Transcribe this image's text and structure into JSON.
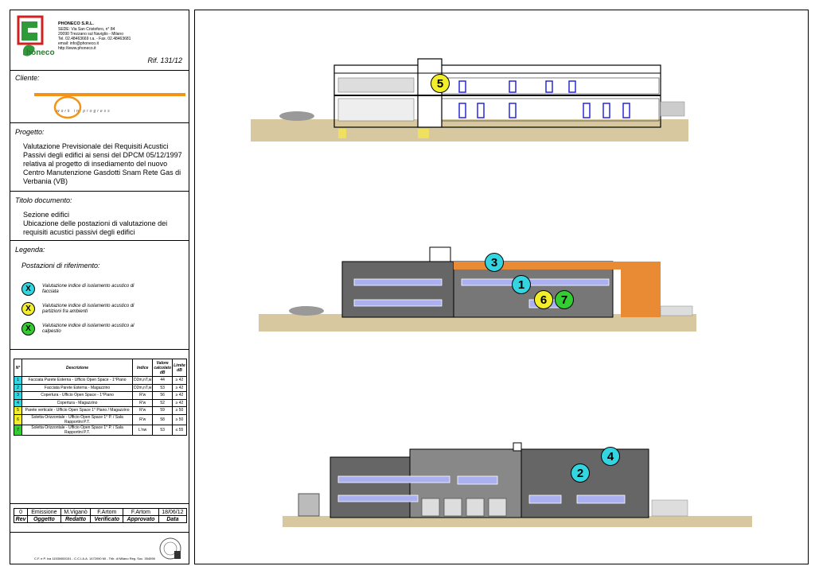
{
  "company": {
    "logo_text": "honeco",
    "name": "PHONECO S.R.L.",
    "address1": "SEDE: Via San Cristoforo, n° 84",
    "address2": "20090 Trezzano sul Naviglio - Milano",
    "phone": "Tel. 02.48463669 r.a. - Fax. 02.48463681",
    "email": "email: info@phoneco.it",
    "web": "http://www.phoneco.it",
    "ref": "Rif. 131/12"
  },
  "client": {
    "label": "Cliente:",
    "logo_text": "work in progress"
  },
  "project": {
    "label": "Progetto:",
    "text": "Valutazione Previsionale dei Requisiti Acustici Passivi degli edifici ai sensi del DPCM 05/12/1997 relativa al progetto di insediamento del nuovo Centro Manutenzione Gasdotti Snam Rete Gas di Verbania (VB)"
  },
  "doc_title": {
    "label": "Titolo documento:",
    "line1": "Sezione edifici",
    "line2": "Ubicazione delle postazioni di valutazione dei requisiti acustici passivi degli edifici"
  },
  "legend": {
    "label": "Legenda:",
    "subtitle": "Postazioni di riferimento:",
    "items": [
      {
        "mark": "X",
        "color": "#33d6e0",
        "text": "Valutazione indice di isolamento acustico di facciata"
      },
      {
        "mark": "X",
        "color": "#f2ee2a",
        "text": "Valutazione indice di isolamento acustico di partizioni fra ambienti"
      },
      {
        "mark": "X",
        "color": "#33cc33",
        "text": "Valutazione indice di isolamento acustico al calpestio"
      }
    ]
  },
  "limits_table": {
    "headers": [
      "N°",
      "Descrizione",
      "Indice",
      "Valore calcolato dB",
      "Limite dB"
    ],
    "rows": [
      {
        "n": "1",
        "color": "#33d6e0",
        "desc": "Facciata Parete Esterna - Ufficio Open Space - 1°Piano",
        "idx": "D2m,nT,w",
        "val": "44",
        "lim": "≥ 42"
      },
      {
        "n": "2",
        "color": "#33d6e0",
        "desc": "Facciata Parete Esterna - Magazzino",
        "idx": "D2m,nT,w",
        "val": "53",
        "lim": "≥ 42"
      },
      {
        "n": "3",
        "color": "#33d6e0",
        "desc": "Copertura - Ufficio Open Space - 1°Piano",
        "idx": "R'w",
        "val": "56",
        "lim": "≥ 42"
      },
      {
        "n": "4",
        "color": "#33d6e0",
        "desc": "Copertura - Magazzino",
        "idx": "R'w",
        "val": "52",
        "lim": "≥ 42"
      },
      {
        "n": "5",
        "color": "#f2ee2a",
        "desc": "Parete verticale - Ufficio Open Space 1° Piano / Magazzino",
        "idx": "R'w",
        "val": "59",
        "lim": "≥ 50"
      },
      {
        "n": "6",
        "color": "#f2ee2a",
        "desc": "Soletta Orizzontale - Ufficio Open Space 1° P. / Sala Rapportini P.T.",
        "idx": "R'w",
        "val": "58",
        "lim": "≥ 50"
      },
      {
        "n": "7",
        "color": "#33cc33",
        "desc": "Soletta Orizzontale - Ufficio Open Space 1° P. / Sala Rapportini P.T.",
        "idx": "L'nw",
        "val": "53",
        "lim": "≤ 55"
      }
    ]
  },
  "revision": {
    "row": [
      "0",
      "Emissione",
      "M.Viganò",
      "F.Artom",
      "F.Artom",
      "18/06/12"
    ],
    "headers": [
      "Rev",
      "Oggetto",
      "Redatto",
      "Verificato",
      "Approvato",
      "Data"
    ]
  },
  "footer": {
    "text": "C.F. e P. Iva 11530650151 - C.C.I.A.A. 1472090 MI - Trib. di Milano Reg. Soc. 354098"
  },
  "markers": [
    {
      "n": "5",
      "color": "#f2ee2a"
    },
    {
      "n": "3",
      "color": "#33d6e0"
    },
    {
      "n": "1",
      "color": "#33d6e0"
    },
    {
      "n": "6",
      "color": "#f2ee2a"
    },
    {
      "n": "7",
      "color": "#33cc33"
    },
    {
      "n": "4",
      "color": "#33d6e0"
    },
    {
      "n": "2",
      "color": "#33d6e0"
    }
  ]
}
